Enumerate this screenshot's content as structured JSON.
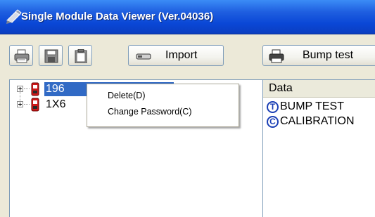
{
  "window": {
    "title": "Single Module Data Viewer (Ver.04036)"
  },
  "toolbar": {
    "print_icon": "printer-icon",
    "save_icon": "floppy-disk-icon",
    "clipboard_icon": "clipboard-icon",
    "import_label": "Import",
    "bump_test_label": "Bump test"
  },
  "tree": {
    "items": [
      {
        "label": "196",
        "selected": true,
        "icon": "device-icon"
      },
      {
        "label": "1X6",
        "selected": false,
        "icon": "device-icon"
      }
    ]
  },
  "context_menu": {
    "items": [
      {
        "label": "Delete(D)"
      },
      {
        "label": "Change Password(C)"
      }
    ]
  },
  "data_panel": {
    "header": "Data",
    "rows": [
      {
        "badge": "T",
        "text": "BUMP TEST"
      },
      {
        "badge": "C",
        "text": "CALIBRATION"
      }
    ]
  },
  "colors": {
    "titlebar": "#0A47D6",
    "selection": "#316AC5",
    "badge": "#1A3FB5",
    "window_bg": "#ECE9D8"
  }
}
